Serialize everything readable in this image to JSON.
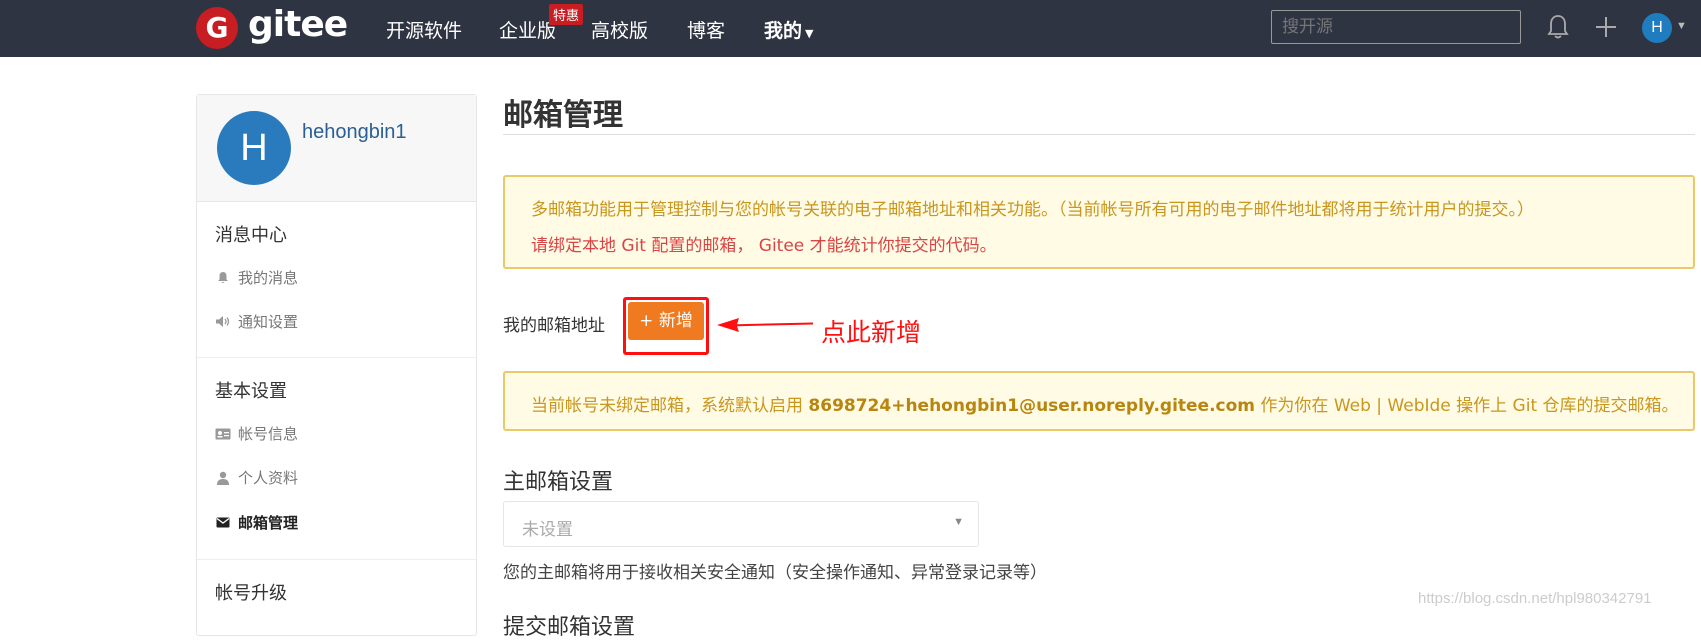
{
  "navbar": {
    "logo_letter": "G",
    "logo_text": "gitee",
    "items": [
      {
        "label": "开源软件"
      },
      {
        "label": "企业版"
      },
      {
        "label": "高校版"
      },
      {
        "label": "博客"
      },
      {
        "label": "我的"
      }
    ],
    "enterprise_badge": "特惠",
    "search_placeholder": "搜开源",
    "avatar_letter": "H",
    "bg_color": "#2f3442",
    "brand_color": "#c71d23"
  },
  "sidebar": {
    "avatar_letter": "H",
    "username": "hehongbin1",
    "sections": [
      {
        "title": "消息中心",
        "items": [
          {
            "label": "我的消息",
            "icon": "bell-icon"
          },
          {
            "label": "通知设置",
            "icon": "speaker-icon"
          }
        ]
      },
      {
        "title": "基本设置",
        "items": [
          {
            "label": "帐号信息",
            "icon": "id-card-icon"
          },
          {
            "label": "个人资料",
            "icon": "user-icon"
          },
          {
            "label": "邮箱管理",
            "icon": "envelope-icon",
            "active": true
          }
        ]
      },
      {
        "title": "帐号升级",
        "items": []
      }
    ]
  },
  "main": {
    "title": "邮箱管理",
    "alert1": {
      "line1": "多邮箱功能用于管理控制与您的帐号关联的电子邮箱地址和相关功能。（当前帐号所有可用的电子邮件地址都将用于统计用户的提交。）",
      "line2": "请绑定本地 Git 配置的邮箱， Gitee 才能统计你提交的代码。"
    },
    "my_email_label": "我的邮箱地址",
    "add_button": "+ 新增",
    "annotation": "点此新增",
    "alert2": {
      "prefix": "当前帐号未绑定邮箱，系统默认启用 ",
      "email": "8698724+hehongbin1@user.noreply.gitee.com",
      "suffix": " 作为你在 Web | WebIde 操作上 Git 仓库的提交邮箱。"
    },
    "primary_email_title": "主邮箱设置",
    "primary_email_select": "未设置",
    "primary_email_hint": "您的主邮箱将用于接收相关安全通知（安全操作通知、异常登录记录等）",
    "next_section_partial": "提交邮箱设置"
  },
  "watermark": "https://blog.csdn.net/hpl980342791",
  "colors": {
    "accent_orange": "#f07a20",
    "annotation_red": "#ff0f0f",
    "alert_border": "#e9c96b",
    "alert_bg": "#fffbe5"
  }
}
